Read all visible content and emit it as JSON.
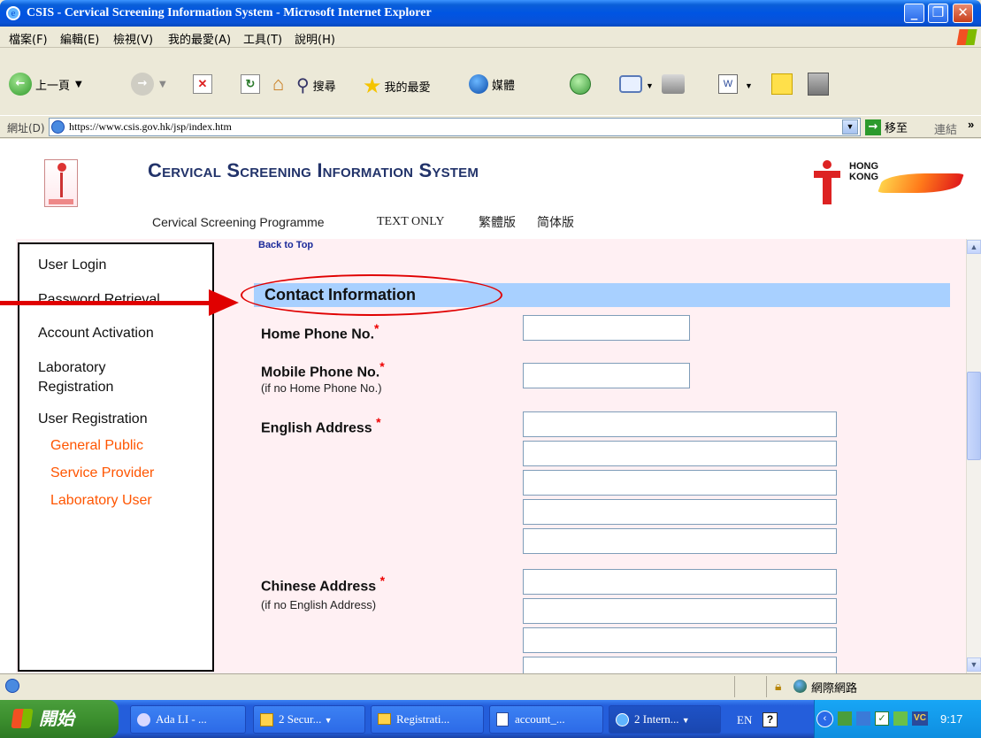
{
  "window": {
    "title": "CSIS - Cervical Screening Information System - Microsoft Internet Explorer"
  },
  "menu": [
    "檔案(F)",
    "編輯(E)",
    "檢視(V)",
    "我的最愛(A)",
    "工具(T)",
    "說明(H)"
  ],
  "toolbar": {
    "back": "上一頁",
    "search": "搜尋",
    "favorites": "我的最愛",
    "media": "媒體"
  },
  "address": {
    "label": "網址(D)",
    "url": "https://www.csis.gov.hk/jsp/index.htm",
    "go": "移至",
    "links": "連結"
  },
  "site": {
    "title": "Cervical Screening Information System",
    "nav": {
      "programme": "Cervical Screening Programme",
      "text_only": "TEXT ONLY",
      "trad": "繁體版",
      "simp": "简体版"
    },
    "hk_logo": "HONG KONG"
  },
  "sidebar": {
    "items": [
      "User Login",
      "Password Retrieval",
      "Account Activation",
      "Laboratory Registration",
      "User Registration"
    ],
    "subitems": [
      "General Public",
      "Service Provider",
      "Laboratory User"
    ]
  },
  "form": {
    "back_to_top": "Back to Top",
    "section_title": "Contact Information",
    "home_phone": "Home Phone No.",
    "mobile_phone": "Mobile Phone No.",
    "mobile_note": "(if no Home Phone No.)",
    "english_address": "English Address",
    "chinese_address": "Chinese Address",
    "chinese_note": "(if no English Address)",
    "required_mark": "*"
  },
  "statusbar": {
    "zone": "網際網路"
  },
  "taskbar": {
    "start": "開始",
    "tasks": [
      "Ada LI - ...",
      "2 Secur...",
      "Registrati...",
      "account_...",
      "2 Intern..."
    ],
    "lang": "EN",
    "clock": "9:17"
  },
  "colors": {
    "accent_red": "#e00000",
    "section_header": "#a8d0ff",
    "sidebar_sub": "#ff5500",
    "content_bg": "#fff0f3"
  }
}
